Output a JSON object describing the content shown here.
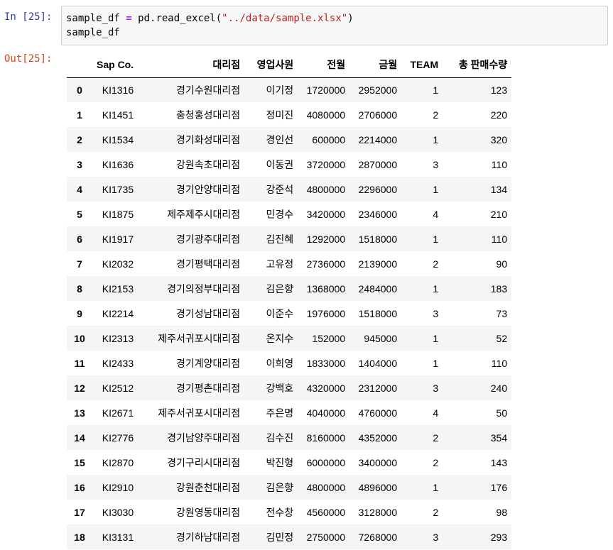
{
  "input_prompt": "In [25]:",
  "output_prompt": "Out[25]:",
  "code": {
    "line1": {
      "var": "sample_df ",
      "op": "=",
      "call": " pd.read_excel(",
      "arg": "\"../data/sample.xlsx\"",
      "close": ")"
    },
    "line2": "sample_df"
  },
  "table": {
    "columns": [
      "",
      "Sap Co.",
      "대리점",
      "영업사원",
      "전월",
      "금월",
      "TEAM",
      "총 판매수량"
    ],
    "rows": [
      [
        "0",
        "KI1316",
        "경기수원대리점",
        "이기정",
        "1720000",
        "2952000",
        "1",
        "123"
      ],
      [
        "1",
        "KI1451",
        "충청홍성대리점",
        "정미진",
        "4080000",
        "2706000",
        "2",
        "220"
      ],
      [
        "2",
        "KI1534",
        "경기화성대리점",
        "경인선",
        "600000",
        "2214000",
        "1",
        "320"
      ],
      [
        "3",
        "KI1636",
        "강원속초대리점",
        "이동권",
        "3720000",
        "2870000",
        "3",
        "110"
      ],
      [
        "4",
        "KI1735",
        "경기안양대리점",
        "강준석",
        "4800000",
        "2296000",
        "1",
        "134"
      ],
      [
        "5",
        "KI1875",
        "제주제주시대리점",
        "민경수",
        "3420000",
        "2346000",
        "4",
        "210"
      ],
      [
        "6",
        "KI1917",
        "경기광주대리점",
        "김진혜",
        "1292000",
        "1518000",
        "1",
        "110"
      ],
      [
        "7",
        "KI2032",
        "경기평택대리점",
        "고유정",
        "2736000",
        "2139000",
        "2",
        "90"
      ],
      [
        "8",
        "KI2153",
        "경기의정부대리점",
        "김은향",
        "1368000",
        "2484000",
        "1",
        "183"
      ],
      [
        "9",
        "KI2214",
        "경기성남대리점",
        "이준수",
        "1976000",
        "1518000",
        "3",
        "73"
      ],
      [
        "10",
        "KI2313",
        "제주서귀포시대리점",
        "온지수",
        "152000",
        "945000",
        "1",
        "52"
      ],
      [
        "11",
        "KI2433",
        "경기계양대리점",
        "이희영",
        "1833000",
        "1404000",
        "1",
        "110"
      ],
      [
        "12",
        "KI2512",
        "경기평촌대리점",
        "강백호",
        "4320000",
        "2312000",
        "3",
        "240"
      ],
      [
        "13",
        "KI2671",
        "제주서귀포시대리점",
        "주은명",
        "4040000",
        "4760000",
        "4",
        "50"
      ],
      [
        "14",
        "KI2776",
        "경기남양주대리점",
        "김수진",
        "8160000",
        "4352000",
        "2",
        "354"
      ],
      [
        "15",
        "KI2870",
        "경기구리시대리점",
        "박진형",
        "6000000",
        "3400000",
        "2",
        "143"
      ],
      [
        "16",
        "KI2910",
        "강원춘천대리점",
        "김은향",
        "4800000",
        "4896000",
        "1",
        "176"
      ],
      [
        "17",
        "KI3030",
        "강원영동대리점",
        "전수창",
        "4560000",
        "3128000",
        "2",
        "98"
      ],
      [
        "18",
        "KI3131",
        "경기하남대리점",
        "김민정",
        "2750000",
        "7268000",
        "3",
        "293"
      ]
    ]
  }
}
